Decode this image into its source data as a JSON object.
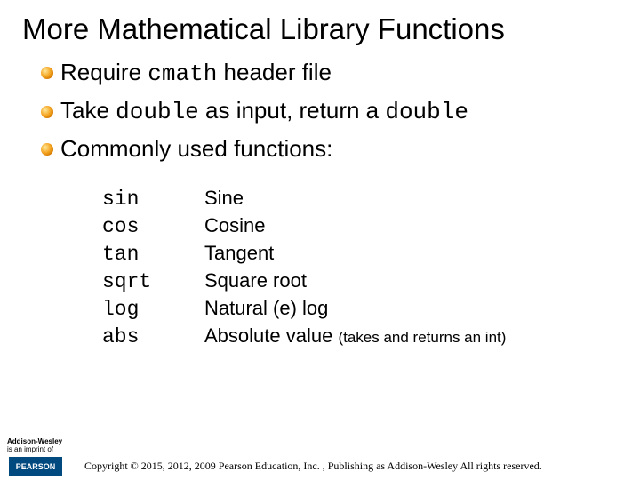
{
  "title": "More Mathematical Library Functions",
  "bullets": [
    {
      "pre": "Require ",
      "code": "cmath",
      "post": " header file"
    },
    {
      "pre": "Take ",
      "code": "double",
      "mid": " as input, return a ",
      "code2": "double",
      "post": ""
    },
    {
      "pre": "Commonly used functions:",
      "code": "",
      "post": ""
    }
  ],
  "functions": [
    {
      "name": "sin",
      "desc": "Sine",
      "note": ""
    },
    {
      "name": "cos",
      "desc": "Cosine",
      "note": ""
    },
    {
      "name": "tan",
      "desc": "Tangent",
      "note": ""
    },
    {
      "name": "sqrt",
      "desc": "Square root",
      "note": ""
    },
    {
      "name": "log",
      "desc": "Natural (e) log",
      "note": ""
    },
    {
      "name": "abs",
      "desc": "Absolute value ",
      "note": "(takes and returns an int)"
    }
  ],
  "footer": {
    "imprint_line1": "Addison-Wesley",
    "imprint_line2": "is an imprint of",
    "publisher": "PEARSON",
    "copyright": "Copyright © 2015, 2012, 2009 Pearson Education, Inc. , Publishing as Addison-Wesley All rights reserved."
  }
}
